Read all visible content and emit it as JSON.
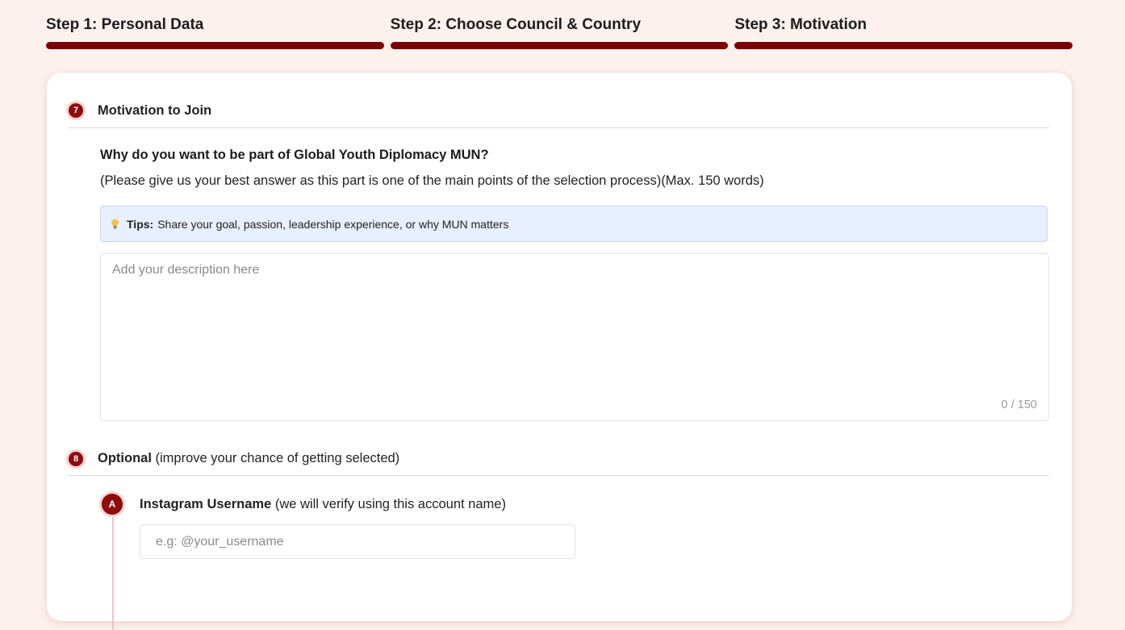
{
  "steps": [
    {
      "label": "Step 1: Personal Data"
    },
    {
      "label": "Step 2: Choose Council & Country"
    },
    {
      "label": "Step 3: Motivation"
    }
  ],
  "colors": {
    "accent": "#7a0006",
    "background": "#fdf1ed",
    "tips_bg": "#e8efff"
  },
  "section7": {
    "number": "7",
    "title": "Motivation to Join",
    "question": "Why do you want to be part of Global Youth Diplomacy MUN?",
    "question_sub": "(Please give us your best answer as this part is one of the main points of the selection process)(Max. 150 words)",
    "tips": {
      "icon": "lightbulb-icon",
      "label": "Tips:",
      "text": "Share your goal, passion, leadership experience, or why MUN matters"
    },
    "textarea": {
      "placeholder": "Add your description here",
      "value": "",
      "counter": "0 / 150"
    }
  },
  "section8": {
    "number": "8",
    "title": "Optional",
    "note": "(improve your chance of getting selected)",
    "items": [
      {
        "badge": "A",
        "title": "Instagram Username",
        "note": "(we will verify using this account name)",
        "placeholder": "e.g: @your_username",
        "value": ""
      }
    ]
  }
}
